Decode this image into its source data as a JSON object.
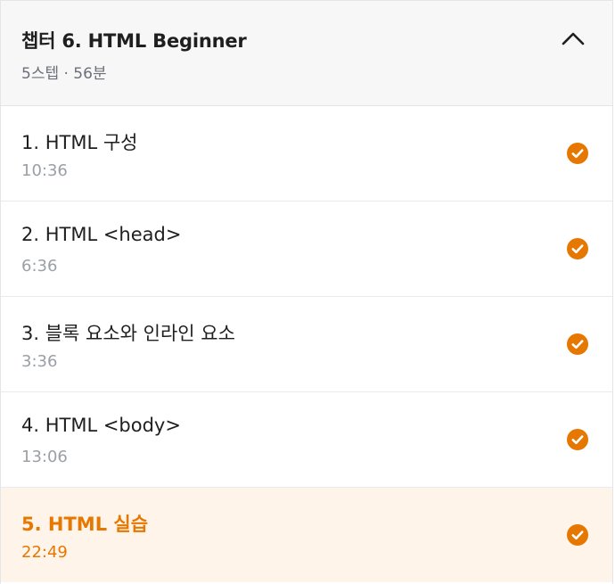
{
  "chapter": {
    "title": "챕터 6. HTML Beginner",
    "meta": "5스텝 · 56분",
    "expanded": true
  },
  "accent_color": "#e67700",
  "active_bg": "#fff4ea",
  "steps": [
    {
      "title": "1. HTML 구성",
      "duration": "10:36",
      "completed": true,
      "active": false
    },
    {
      "title": "2. HTML <head>",
      "duration": "6:36",
      "completed": true,
      "active": false
    },
    {
      "title": "3. 블록 요소와 인라인 요소",
      "duration": "3:36",
      "completed": true,
      "active": false
    },
    {
      "title": "4. HTML <body>",
      "duration": "13:06",
      "completed": true,
      "active": false
    },
    {
      "title": "5. HTML 실습",
      "duration": "22:49",
      "completed": true,
      "active": true
    }
  ]
}
